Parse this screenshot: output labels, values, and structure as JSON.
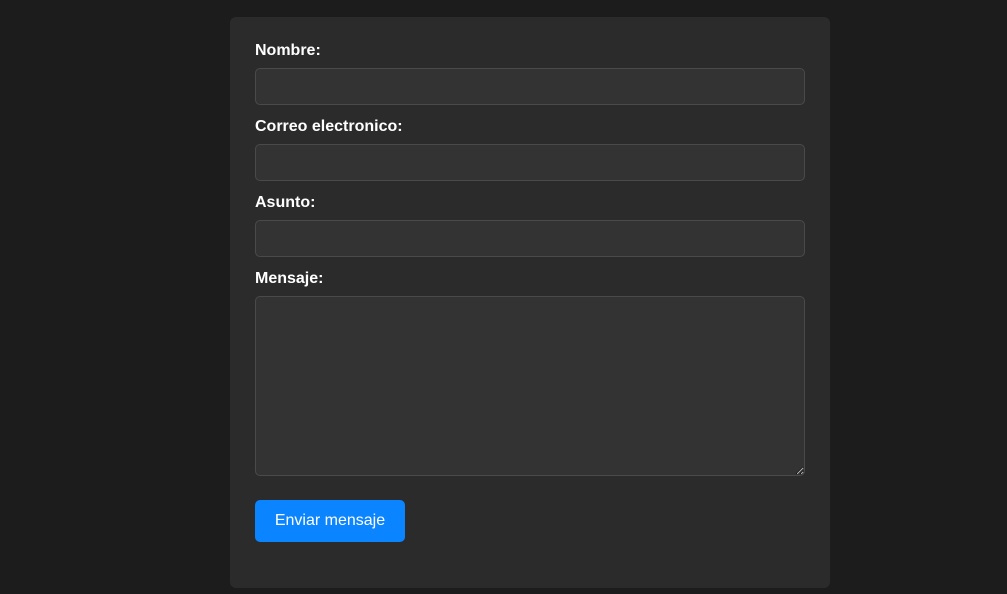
{
  "form": {
    "fields": [
      {
        "label": "Nombre:",
        "value": "",
        "placeholder": ""
      },
      {
        "label": "Correo electronico:",
        "value": "",
        "placeholder": ""
      },
      {
        "label": "Asunto:",
        "value": "",
        "placeholder": ""
      },
      {
        "label": "Mensaje:",
        "value": "",
        "placeholder": ""
      }
    ],
    "submit_label": "Enviar mensaje"
  },
  "colors": {
    "page_background": "#1c1c1c",
    "card_background": "#2b2b2b",
    "input_background": "#333333",
    "input_border": "#4a4a4a",
    "button_background": "#0a84ff",
    "text": "#ffffff"
  }
}
